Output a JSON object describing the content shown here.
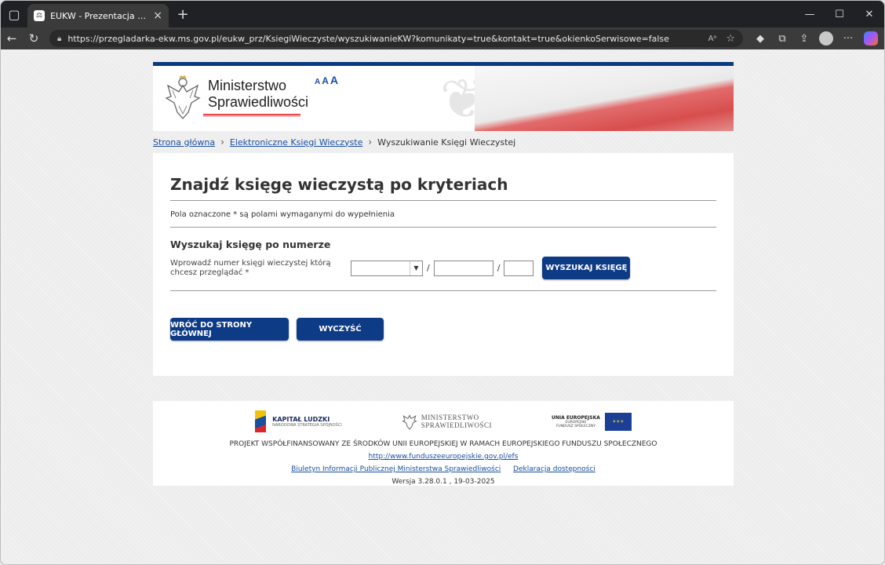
{
  "browser": {
    "tab_title": "EUKW - Prezentacja Księgi Wieczystej",
    "url": "https://przegladarka-ekw.ms.gov.pl/eukw_prz/KsiegiWieczyste/wyszukiwanieKW?komunikaty=true&kontakt=true&okienkoSerwisowe=false",
    "read_aloud": "A⁾"
  },
  "header": {
    "ministry_line1": "Ministerstwo",
    "ministry_line2": "Sprawiedliwości",
    "font_small": "A",
    "font_medium": "A",
    "font_large": "A"
  },
  "breadcrumb": {
    "home": "Strona główna",
    "ekw": "Elektroniczne Księgi Wieczyste",
    "current": "Wyszukiwanie Księgi Wieczystej"
  },
  "form": {
    "title": "Znajdź księgę wieczystą po kryteriach",
    "required_note": "Pola oznaczone * są polami wymaganymi do wypełnienia",
    "section_title": "Wyszukaj księgę po numerze",
    "field_label": "Wprowadź numer księgi wieczystej którą chcesz przeglądać *",
    "court_code_value": "",
    "book_number_value": "",
    "check_digit_value": "",
    "slash": "/",
    "search_button": "WYSZUKAJ KSIĘGĘ",
    "back_button": "WRÓĆ DO STRONY GŁÓWNEJ",
    "clear_button": "WYCZYŚĆ"
  },
  "footer": {
    "kl_title": "KAPITAŁ LUDZKI",
    "kl_subtitle": "NARODOWA STRATEGIA SPÓJNOŚCI",
    "ms_line1": "MINISTERSTWO",
    "ms_line2": "SPRAWIEDLIWOŚCI",
    "ue_title": "UNIA EUROPEJSKA",
    "ue_line2": "EUROPEJSKI",
    "ue_line3": "FUNDUSZ SPOŁECZNY",
    "project_text": "PROJEKT WSPÓŁFINANSOWANY ZE ŚRODKÓW UNII EUROPEJSKIEJ W RAMACH EUROPEJSKIEGO FUNDUSZU SPOŁECZNEGO",
    "efs_link": "http://www.funduszeeuropejskie.gov.pl/efs",
    "bip_link": "Biuletyn Informacji Publicznej Ministerstwa Sprawiedliwości",
    "accessibility_link": "Deklaracja dostępności",
    "version": "Wersja 3.28.0.1 , 19-03-2025"
  },
  "colors": {
    "primary": "#0e3b86",
    "link": "#1a4fa0",
    "accent_red": "#e5484d"
  }
}
